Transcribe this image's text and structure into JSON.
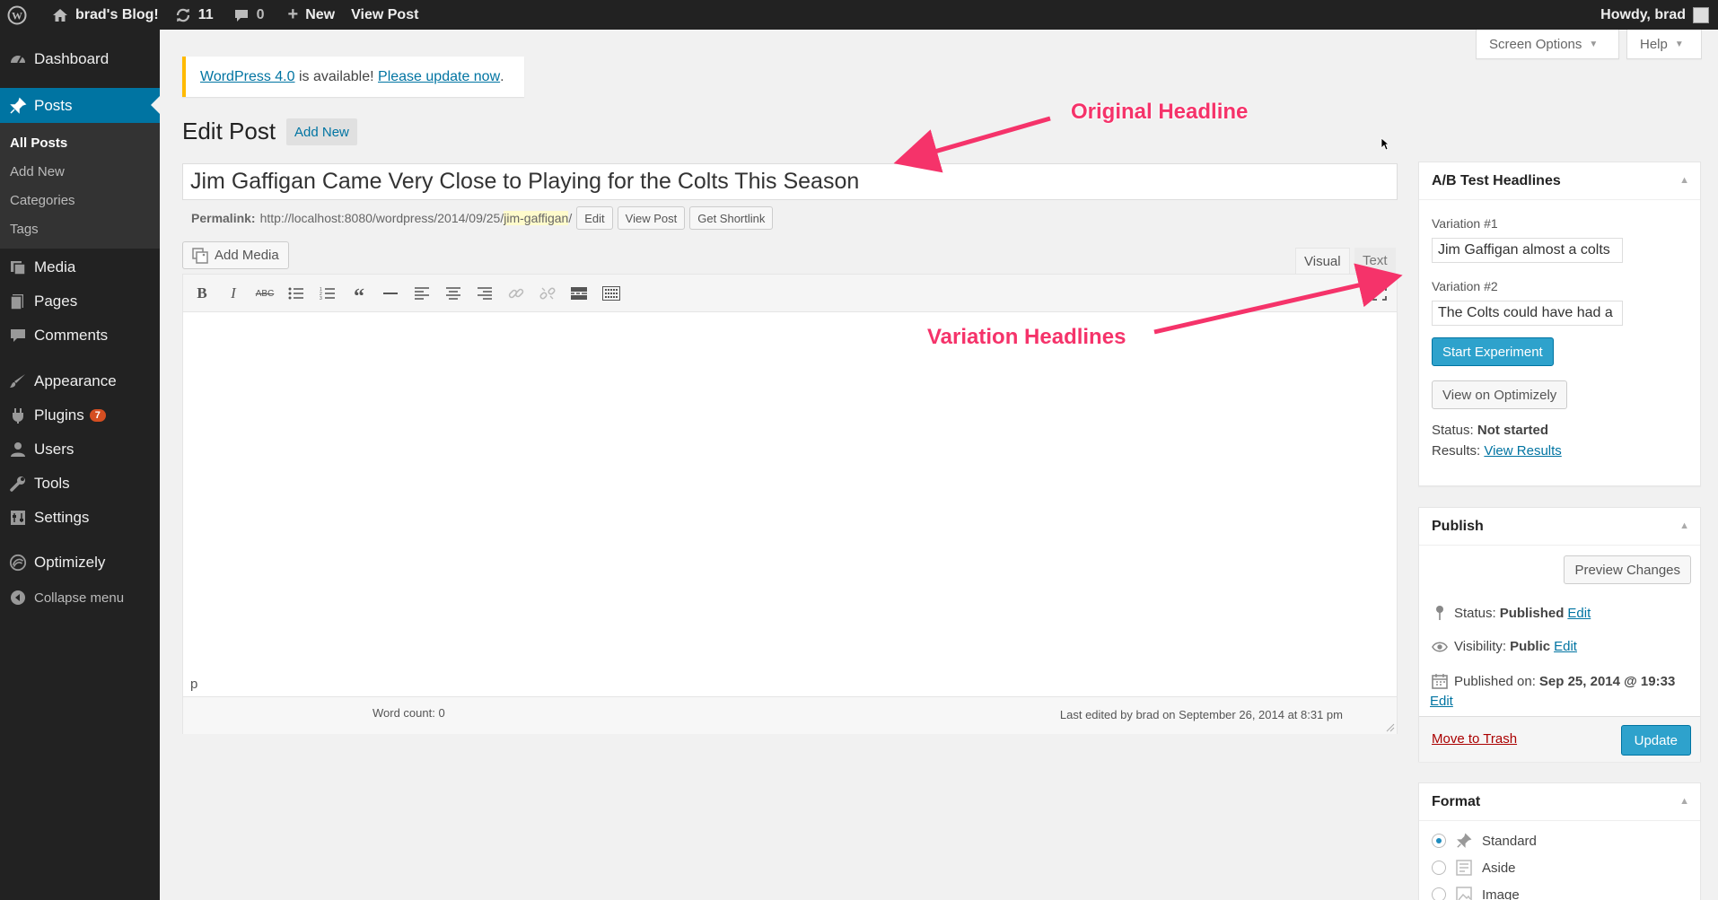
{
  "adminbar": {
    "site_name": "brad's Blog!",
    "updates_count": "11",
    "comments_count": "0",
    "new_label": "New",
    "view_post_label": "View Post",
    "howdy": "Howdy, brad"
  },
  "sidebar": {
    "dashboard": "Dashboard",
    "posts": "Posts",
    "submenu": [
      "All Posts",
      "Add New",
      "Categories",
      "Tags"
    ],
    "media": "Media",
    "pages": "Pages",
    "comments": "Comments",
    "appearance": "Appearance",
    "plugins": "Plugins",
    "plugins_badge": "7",
    "users": "Users",
    "tools": "Tools",
    "settings": "Settings",
    "optimizely": "Optimizely",
    "collapse": "Collapse menu"
  },
  "notice": {
    "link1": "WordPress 4.0",
    "middle": " is available! ",
    "link2": "Please update now",
    "end": "."
  },
  "screen_options": "Screen Options",
  "help": "Help",
  "page_title": "Edit Post",
  "add_new": "Add New",
  "post_title": "Jim Gaffigan Came Very Close to Playing for the Colts This Season",
  "permalink": {
    "label": "Permalink:",
    "url": "http://localhost:8080/wordpress/2014/09/25/",
    "slug": "jim-gaffigan",
    "trail": "/",
    "edit": "Edit",
    "view_post": "View Post",
    "get_shortlink": "Get Shortlink"
  },
  "add_media": "Add Media",
  "tabs": {
    "visual": "Visual",
    "text": "Text"
  },
  "editor": {
    "path": "p",
    "word_count": "Word count: 0",
    "last_edited": "Last edited by brad on September 26, 2014 at 8:31 pm"
  },
  "ab_box": {
    "title": "A/B Test Headlines",
    "variation1_label": "Variation #1",
    "variation1_value": "Jim Gaffigan almost a colts",
    "variation2_label": "Variation #2",
    "variation2_value": "The Colts could have had a",
    "start": "Start Experiment",
    "view": "View on Optimizely",
    "status_label": "Status:",
    "status_value": "Not started",
    "results_label": "Results:",
    "results_link": "View Results"
  },
  "publish": {
    "title": "Publish",
    "preview": "Preview Changes",
    "status_label": "Status:",
    "status_value": "Published",
    "edit": "Edit",
    "visibility_label": "Visibility:",
    "visibility_value": "Public",
    "published_label": "Published on:",
    "published_value": "Sep 25, 2014 @ 19:33",
    "trash": "Move to Trash",
    "update": "Update"
  },
  "format": {
    "title": "Format",
    "options": [
      "Standard",
      "Aside",
      "Image"
    ]
  },
  "annotations": {
    "original": "Original Headline",
    "variation": "Variation Headlines"
  },
  "colors": {
    "accent": "#0074a2",
    "primary_button": "#2ea2cc",
    "annotation": "#f5336a",
    "sidebar": "#222222"
  }
}
